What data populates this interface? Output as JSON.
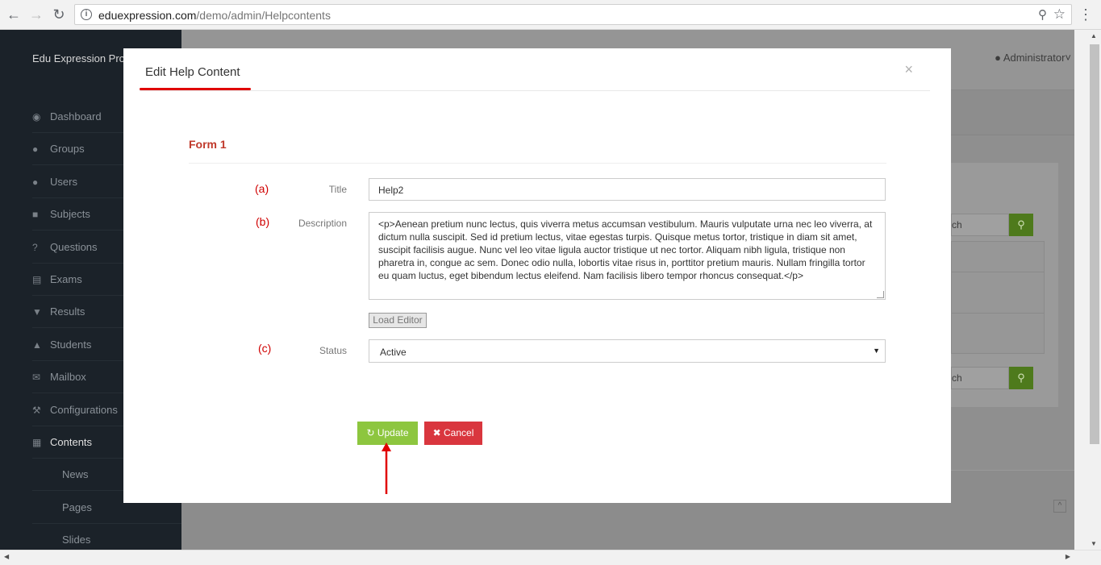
{
  "browser": {
    "url_host": "eduexpression.com",
    "url_path": "/demo/admin/Helpcontents"
  },
  "app": {
    "brand": "Edu Expression Pro",
    "user_menu": "Administrator"
  },
  "sidebar": {
    "items": [
      {
        "label": "Dashboard",
        "icon": "dashboard-icon"
      },
      {
        "label": "Groups",
        "icon": "groups-icon"
      },
      {
        "label": "Users",
        "icon": "user-icon"
      },
      {
        "label": "Subjects",
        "icon": "book-icon"
      },
      {
        "label": "Questions",
        "icon": "question-icon"
      },
      {
        "label": "Exams",
        "icon": "list-icon"
      },
      {
        "label": "Results",
        "icon": "trophy-icon"
      },
      {
        "label": "Students",
        "icon": "graduation-icon"
      },
      {
        "label": "Mailbox",
        "icon": "envelope-icon"
      },
      {
        "label": "Configurations",
        "icon": "wrench-icon"
      },
      {
        "label": "Contents",
        "icon": "newspaper-icon"
      }
    ],
    "subitems": [
      "News",
      "Pages",
      "Slides"
    ]
  },
  "background": {
    "search_text": "ch"
  },
  "modal": {
    "title": "Edit Help Content",
    "close": "×",
    "form_heading": "Form 1",
    "fields": {
      "title": {
        "annotation": "(a)",
        "label": "Title",
        "value": "Help2"
      },
      "description": {
        "annotation": "(b)",
        "label": "Description",
        "value": "<p>Aenean pretium nunc lectus, quis viverra metus accumsan vestibulum. Mauris vulputate urna nec leo viverra, at dictum nulla suscipit. Sed id pretium lectus, vitae egestas turpis. Quisque metus tortor, tristique in diam sit amet, suscipit facilisis augue. Nunc vel leo vitae ligula auctor tristique ut nec tortor. Aliquam nibh ligula, tristique non pharetra in, congue ac sem. Donec odio nulla, lobortis vitae risus in, porttitor pretium mauris. Nullam fringilla tortor eu quam luctus, eget bibendum lectus eleifend. Nam facilisis libero tempor rhoncus consequat.</p>"
      },
      "status": {
        "annotation": "(c)",
        "label": "Status",
        "value": "Active"
      }
    },
    "load_editor": "Load Editor",
    "update": "Update",
    "cancel": "Cancel"
  },
  "colors": {
    "sidebar_bg": "#1b2229",
    "update_green": "#8dc63f",
    "cancel_red": "#d9363e",
    "annotation_red": "#d00000",
    "heading_red": "#c0392b"
  }
}
